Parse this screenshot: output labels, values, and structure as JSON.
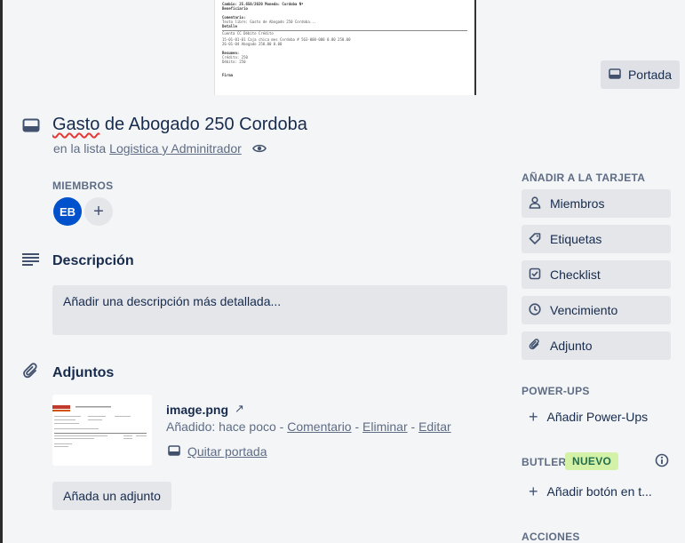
{
  "cover": {
    "button_label": "Portada",
    "doc_lines": [
      {
        "text": "Cambio:      25.650/2020         Moneda:    Cordoba          Nº",
        "bold": true
      },
      {
        "text": "Beneficiario",
        "bold": true
      },
      {
        "text": ""
      },
      {
        "text": "Comentario:",
        "bold": true
      },
      {
        "text": "Texto libre: Gasto de Abogado 250 Cordoba..."
      },
      {
        "text": "Detalle",
        "bold": true
      },
      {
        "text": "Cuenta                                  CC              Débito        Crédito",
        "rule": true
      },
      {
        "text": "15-01-01-01 Caja chica mes Cordoba # 563-000-000           0.00        250.00"
      },
      {
        "text": "26-01-04 Abogado                                         250.00         0.00"
      },
      {
        "text": ""
      },
      {
        "text": "Resumen:",
        "bold": true
      },
      {
        "text": "Crédito:     250"
      },
      {
        "text": "Débito:      250"
      },
      {
        "text": ""
      },
      {
        "text": ""
      },
      {
        "text": "Firma",
        "bold": true
      }
    ]
  },
  "card": {
    "title_before": "",
    "title_spell": "Gasto",
    "title_after": " de Abogado 250 Cordoba",
    "list_prefix": "en la lista",
    "list_name": "Logistica y Adminitrador"
  },
  "members": {
    "heading": "MIEMBROS",
    "avatar_initials": "EB",
    "add_symbol": "+"
  },
  "description": {
    "heading": "Descripción",
    "placeholder": "Añadir una descripción más detallada..."
  },
  "attachments": {
    "heading": "Adjuntos",
    "file_name": "image.png",
    "arrow": "↗",
    "added_text": "Añadido: hace poco",
    "sep": " - ",
    "comment_link": "Comentario",
    "delete_link": "Eliminar",
    "edit_link": "Editar",
    "remove_cover_link": "Quitar portada",
    "add_button": "Añada un adjunto"
  },
  "sidebar": {
    "add_heading": "AÑADIR A LA TARJETA",
    "items": [
      {
        "label": "Miembros",
        "icon": "person-icon"
      },
      {
        "label": "Etiquetas",
        "icon": "tag-icon"
      },
      {
        "label": "Checklist",
        "icon": "checklist-icon"
      },
      {
        "label": "Vencimiento",
        "icon": "clock-icon"
      },
      {
        "label": "Adjunto",
        "icon": "paperclip-icon"
      }
    ],
    "powerups_heading": "POWER-UPS",
    "powerups_add": "Añadir Power-Ups",
    "butler_heading": "BUTLER",
    "butler_badge": "NUEVO",
    "butler_add": "Añadir botón en t...",
    "actions_heading": "ACCIONES"
  },
  "colors": {
    "accent": "#0052cc",
    "card_bg": "#f4f5f7",
    "button_bg": "#e4e6ea",
    "badge_bg": "#d3f1a7"
  }
}
